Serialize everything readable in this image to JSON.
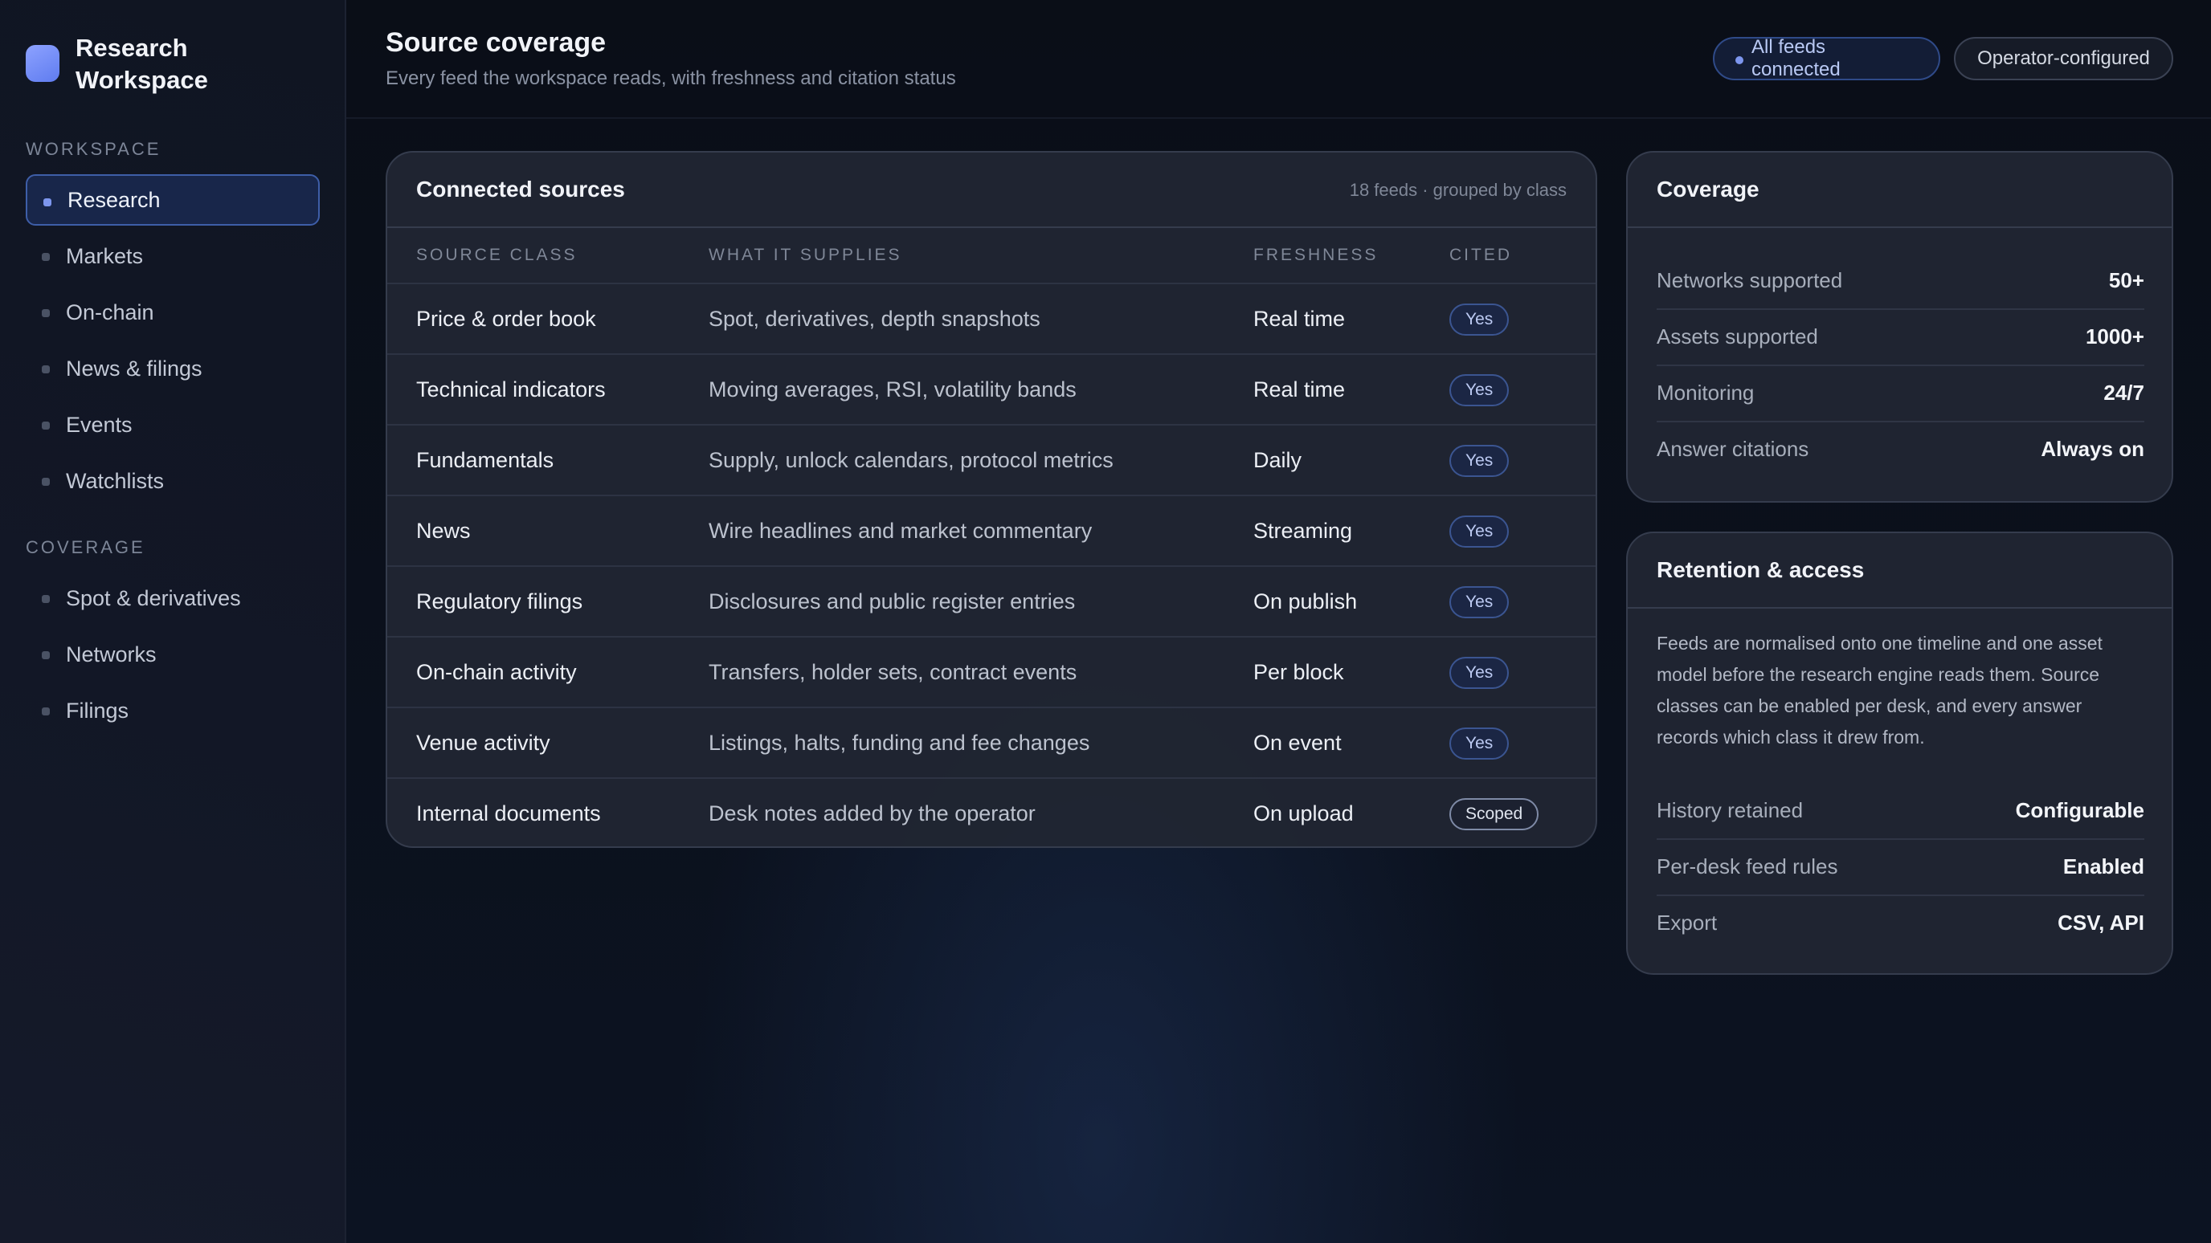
{
  "sidebar": {
    "brand": "Research Workspace",
    "sections": [
      {
        "label": "WORKSPACE",
        "items": [
          "Research",
          "Markets",
          "On-chain",
          "News & filings",
          "Events",
          "Watchlists"
        ]
      },
      {
        "label": "COVERAGE",
        "items": [
          "Spot & derivatives",
          "Networks",
          "Filings"
        ]
      }
    ],
    "active_item": "Research"
  },
  "header": {
    "title": "Source coverage",
    "subtitle": "Every feed the workspace reads, with freshness and citation status",
    "status_pill": "All feeds connected",
    "config_pill": "Operator-configured"
  },
  "sources": {
    "title": "Connected sources",
    "meta": "18 feeds · grouped by class",
    "columns": [
      "SOURCE CLASS",
      "WHAT IT SUPPLIES",
      "FRESHNESS",
      "CITED"
    ],
    "rows": [
      {
        "source_class": "Price & order book",
        "supplies": "Spot, derivatives, depth snapshots",
        "freshness": "Real time",
        "cited": "Yes"
      },
      {
        "source_class": "Technical indicators",
        "supplies": "Moving averages, RSI, volatility bands",
        "freshness": "Real time",
        "cited": "Yes"
      },
      {
        "source_class": "Fundamentals",
        "supplies": "Supply, unlock calendars, protocol metrics",
        "freshness": "Daily",
        "cited": "Yes"
      },
      {
        "source_class": "News",
        "supplies": "Wire headlines and market commentary",
        "freshness": "Streaming",
        "cited": "Yes"
      },
      {
        "source_class": "Regulatory filings",
        "supplies": "Disclosures and public register entries",
        "freshness": "On publish",
        "cited": "Yes"
      },
      {
        "source_class": "On-chain activity",
        "supplies": "Transfers, holder sets, contract events",
        "freshness": "Per block",
        "cited": "Yes"
      },
      {
        "source_class": "Venue activity",
        "supplies": "Listings, halts, funding and fee changes",
        "freshness": "On event",
        "cited": "Yes"
      },
      {
        "source_class": "Internal documents",
        "supplies": "Desk notes added by the operator",
        "freshness": "On upload",
        "cited": "Scoped"
      }
    ]
  },
  "coverage": {
    "title": "Coverage",
    "items": [
      {
        "label": "Networks supported",
        "value": "50+"
      },
      {
        "label": "Assets supported",
        "value": "1000+"
      },
      {
        "label": "Monitoring",
        "value": "24/7"
      },
      {
        "label": "Answer citations",
        "value": "Always on"
      }
    ]
  },
  "retention": {
    "title": "Retention & access",
    "body": "Feeds are normalised onto one timeline and one asset model before the research engine reads them. Source classes can be enabled per desk, and every answer records which class it drew from.",
    "items": [
      {
        "label": "History retained",
        "value": "Configurable"
      },
      {
        "label": "Per-desk feed rules",
        "value": "Enabled"
      },
      {
        "label": "Export",
        "value": "CSV, API"
      }
    ]
  }
}
